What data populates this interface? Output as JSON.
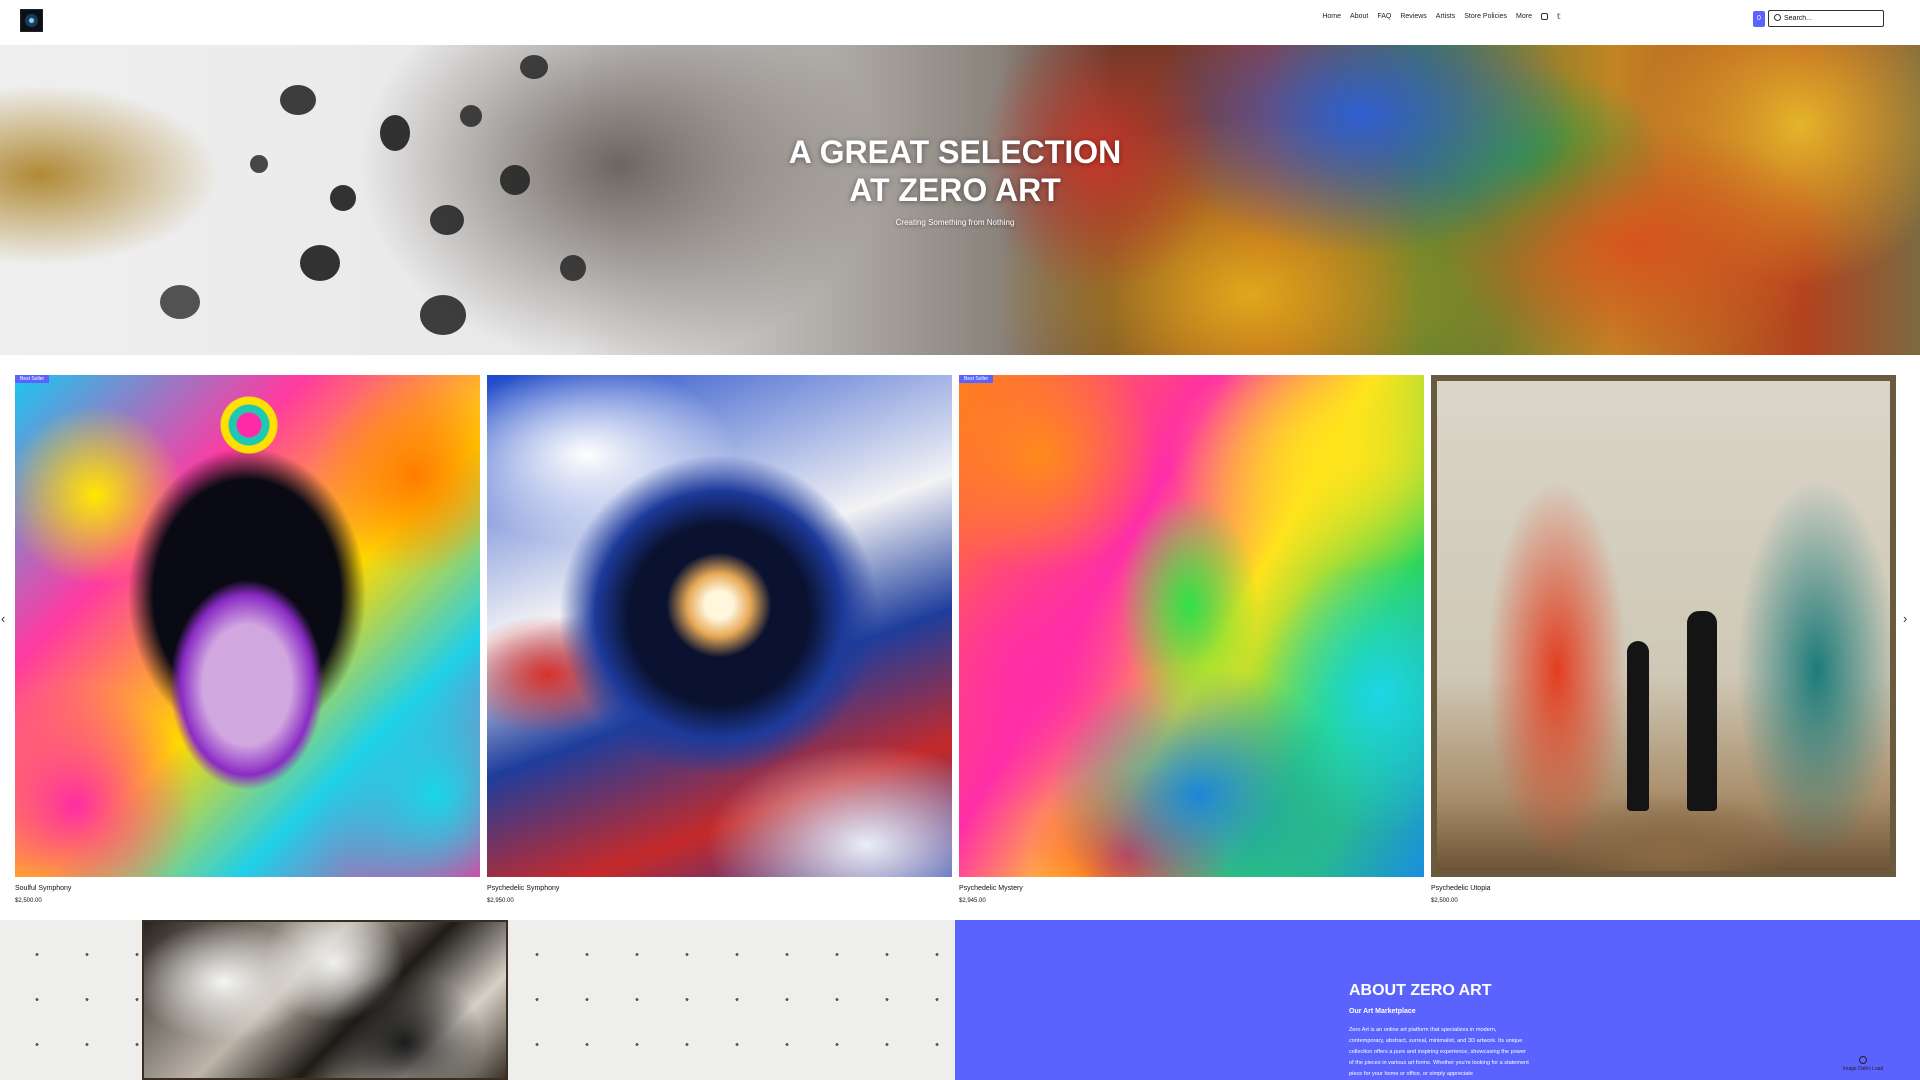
{
  "header": {
    "nav": [
      "Home",
      "About",
      "FAQ",
      "Reviews",
      "Artists",
      "Store Policies",
      "More"
    ],
    "cart_count": "0",
    "search": {
      "placeholder": "Search..."
    }
  },
  "hero": {
    "title_line1": "A GREAT SELECTION",
    "title_line2": "AT ZERO ART",
    "subtitle": "Creating Something from Nothing"
  },
  "gallery": {
    "items": [
      {
        "name": "Soulful Symphony",
        "price": "$2,500.00",
        "ribbon": "Best Seller"
      },
      {
        "name": "Psychedelic Symphony",
        "price": "$2,950.00",
        "ribbon": ""
      },
      {
        "name": "Psychedelic Mystery",
        "price": "$2,945.00",
        "ribbon": "Best Seller"
      },
      {
        "name": "Psychedelic Utopia",
        "price": "$2,500.00",
        "ribbon": ""
      }
    ]
  },
  "about": {
    "title": "ABOUT ZERO ART",
    "subtitle": "Our Art Marketplace",
    "body": "Zero Art is an online art platform that specializes in modern, contemporary, abstract, surreal, minimalist, and 3D artwork. Its unique collection offers a pure and inspiring experience, showcasing the power of the pieces in various art forms. Whether you're looking for a statement piece for your home or office, or simply appreciate",
    "badge": "Image Didn't Load"
  },
  "colors": {
    "accent": "#5b63ff"
  },
  "icons": [
    "instagram-icon",
    "twitter-icon",
    "cart-icon",
    "search-icon",
    "chevron-left-icon",
    "chevron-right-icon"
  ]
}
